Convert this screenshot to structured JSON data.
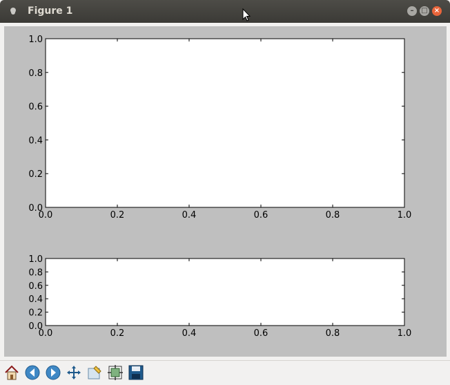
{
  "window": {
    "title": "Figure 1",
    "icons": [
      "menu-icon",
      "minimize-icon",
      "maximize-icon",
      "close-icon"
    ]
  },
  "chart_data": [
    {
      "type": "line",
      "series": [],
      "xlim": [
        0.0,
        1.0
      ],
      "ylim": [
        0.0,
        1.0
      ],
      "xticks": [
        "0.0",
        "0.2",
        "0.4",
        "0.6",
        "0.8",
        "1.0"
      ],
      "yticks": [
        "0.0",
        "0.2",
        "0.4",
        "0.6",
        "0.8",
        "1.0"
      ],
      "grid": false
    },
    {
      "type": "line",
      "series": [],
      "xlim": [
        0.0,
        1.0
      ],
      "ylim": [
        0.0,
        1.0
      ],
      "xticks": [
        "0.0",
        "0.2",
        "0.4",
        "0.6",
        "0.8",
        "1.0"
      ],
      "yticks": [
        "0.0",
        "0.2",
        "0.4",
        "0.6",
        "0.8",
        "1.0"
      ],
      "grid": false
    }
  ],
  "colors": {
    "figure_background": "#bfbfbf",
    "axes_background": "#ffffff",
    "titlebar": "#3c3b37",
    "close_button": "#e9653b"
  },
  "toolbar": {
    "buttons": [
      "home-icon",
      "back-icon",
      "forward-icon",
      "pan-icon",
      "zoom-icon",
      "subplots-icon",
      "save-icon"
    ]
  }
}
